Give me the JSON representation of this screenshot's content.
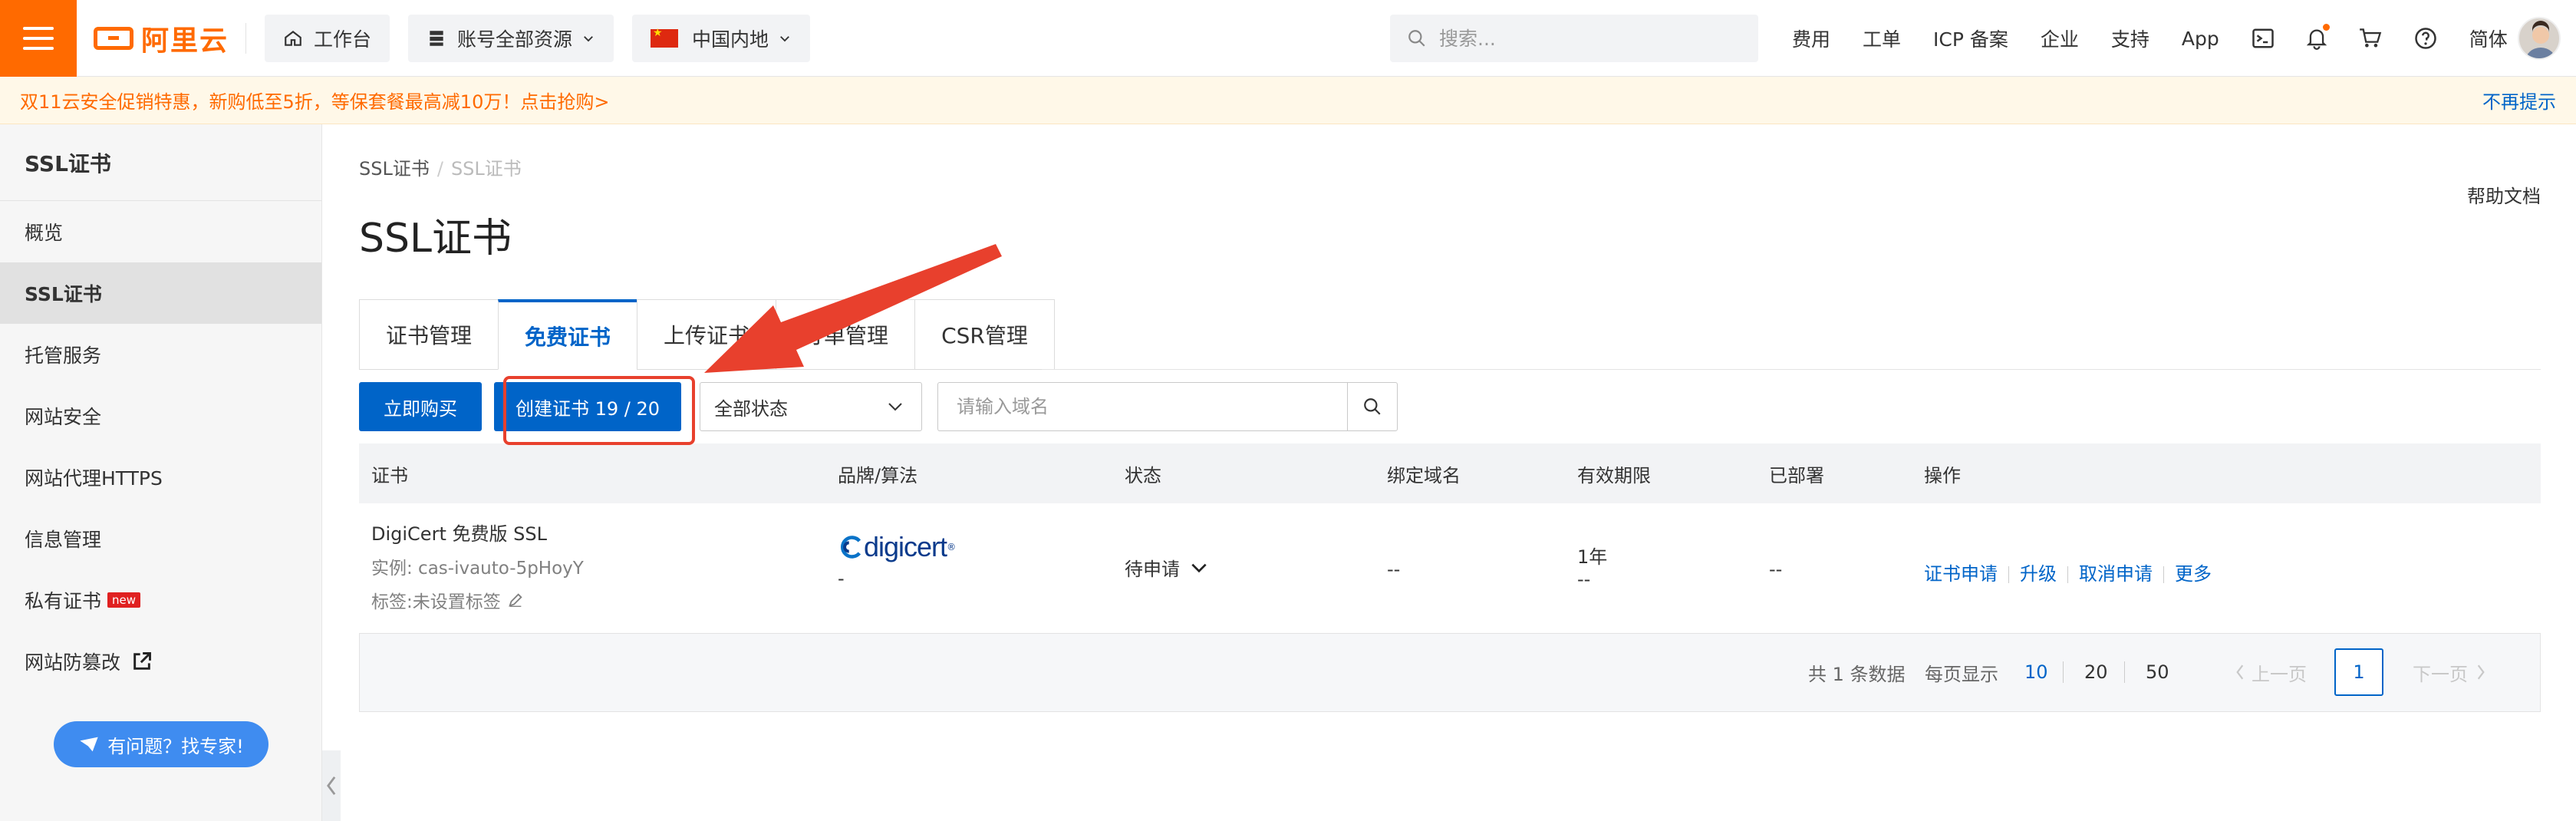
{
  "topbar": {
    "brand": "阿里云",
    "workbench": "工作台",
    "resources": "账号全部资源",
    "region": "中国内地",
    "search_placeholder": "搜索...",
    "links": [
      "费用",
      "工单",
      "ICP 备案",
      "企业",
      "支持",
      "App"
    ],
    "language": "简体",
    "icons": [
      "terminal-icon",
      "bell-icon",
      "cart-icon",
      "help-circle-icon"
    ]
  },
  "promo": {
    "text": "双11云安全促销特惠，新购低至5折，等保套餐最高减10万！点击抢购>",
    "dismiss": "不再提示"
  },
  "sidebar": {
    "title": "SSL证书",
    "items": [
      {
        "label": "概览"
      },
      {
        "label": "SSL证书"
      },
      {
        "label": "托管服务"
      },
      {
        "label": "网站安全"
      },
      {
        "label": "网站代理HTTPS"
      },
      {
        "label": "信息管理"
      },
      {
        "label": "私有证书",
        "badge": "new"
      },
      {
        "label": "网站防篡改"
      }
    ],
    "help": "有问题？找专家!"
  },
  "breadcrumb": [
    "SSL证书",
    "SSL证书"
  ],
  "help_doc": "帮助文档",
  "page_title": "SSL证书",
  "tabs": [
    "证书管理",
    "免费证书",
    "上传证书",
    "订单管理",
    "CSR管理"
  ],
  "toolbar": {
    "buy": "立即购买",
    "create": "创建证书 19 / 20",
    "status_select": "全部状态",
    "domain_placeholder": "请输入域名"
  },
  "table": {
    "headers": [
      "证书",
      "品牌/算法",
      "状态",
      "绑定域名",
      "有效期限",
      "已部署",
      "操作"
    ],
    "rows": [
      {
        "name": "DigiCert 免费版 SSL",
        "instance": "实例: cas-ivauto-5pHoyY",
        "tag": "标签:未设置标签",
        "brand_logo": "digicert",
        "algo": "-",
        "status": "待申请",
        "domain": "--",
        "validity": "1年",
        "validity_sub": "--",
        "deployed": "--",
        "ops": [
          "证书申请",
          "升级",
          "取消申请",
          "更多"
        ]
      }
    ]
  },
  "pagination": {
    "total": "共 1 条数据",
    "per_page_label": "每页显示",
    "sizes": [
      "10",
      "20",
      "50"
    ],
    "prev": "上一页",
    "current": "1",
    "next": "下一页"
  },
  "colors": {
    "brand_orange": "#ff6a00",
    "primary_blue": "#0064c8",
    "annotation_red": "#e8402d"
  }
}
